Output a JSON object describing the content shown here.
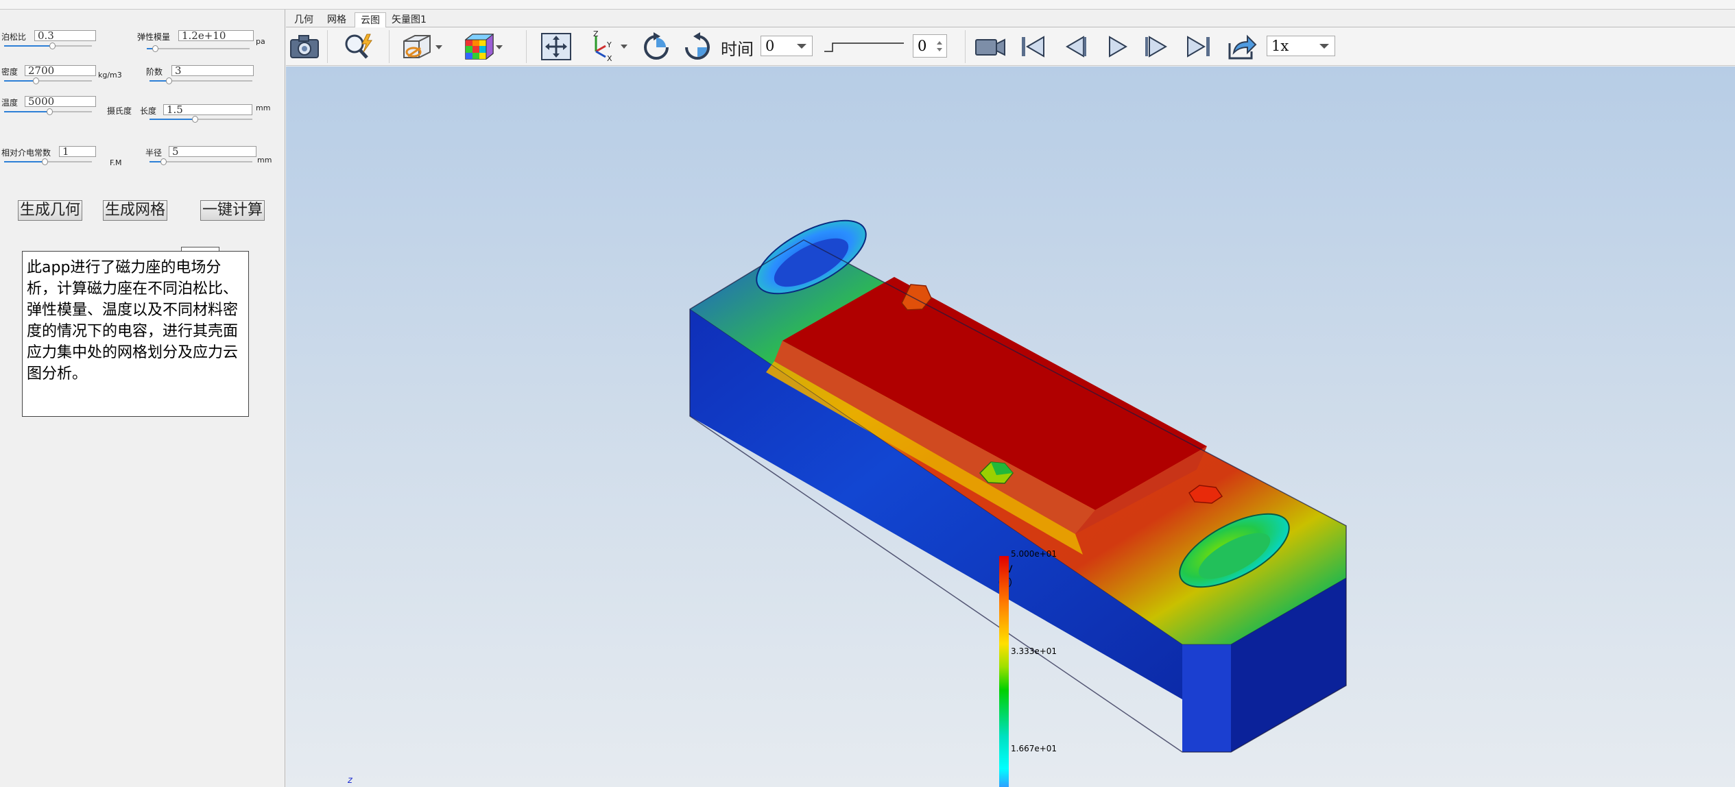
{
  "tabs": [
    "几何",
    "网格",
    "云图",
    "矢量图1"
  ],
  "params": {
    "poisson": {
      "label": "泊松比",
      "value": "0.3",
      "slider": 0.55
    },
    "youngs": {
      "label": "弹性模量",
      "value": "1.2e+10",
      "unit": "pa",
      "slider": 0.08
    },
    "density": {
      "label": "密度",
      "value": "2700",
      "unit": "kg/m3",
      "slider": 0.35
    },
    "order": {
      "label": "阶数",
      "value": "3",
      "slider": 0.18
    },
    "temperature": {
      "label": "温度",
      "value": "5000",
      "slider": 0.5
    },
    "celsius_label": "摄氏度",
    "length": {
      "label": "长度",
      "value": "1.5",
      "unit": "mm",
      "slider": 0.45
    },
    "permittivity": {
      "label": "相对介电常数",
      "value": "1",
      "unit": "F.M",
      "slider": 0.45
    },
    "radius": {
      "label": "半径",
      "value": "5",
      "unit": "mm",
      "slider": 0.12
    }
  },
  "buttons": {
    "gen_geometry": "生成几何",
    "gen_mesh": "生成网格",
    "compute": "一键计算"
  },
  "description": "此app进行了磁力座的电场分析，计算磁力座在不同泊松比、弹性模量、温度以及不同材料密度的情况下的电容，进行其壳面应力集中处的网格划分及应力云图分析。",
  "toolbar": {
    "time_label": "时间",
    "time_value": "0",
    "spin_value": "0",
    "speed_value": "1x",
    "icons": [
      "camera-icon",
      "zoom-icon",
      "view-cube-icon",
      "color-cube-icon",
      "fit-view-icon",
      "axis-icon",
      "rotate-left-icon",
      "rotate-right-icon",
      "record-icon",
      "first-frame-icon",
      "prev-frame-icon",
      "play-icon",
      "next-frame-icon",
      "last-frame-icon",
      "export-icon"
    ]
  },
  "legend": {
    "title": "V",
    "unit": "（V）",
    "ticks": [
      "5.000e+01",
      "3.333e+01",
      "1.667e+01"
    ],
    "colors": {
      "high": "#e00000",
      "mid": "#00d000",
      "low": "#00ffff"
    }
  },
  "triad_label": "z"
}
